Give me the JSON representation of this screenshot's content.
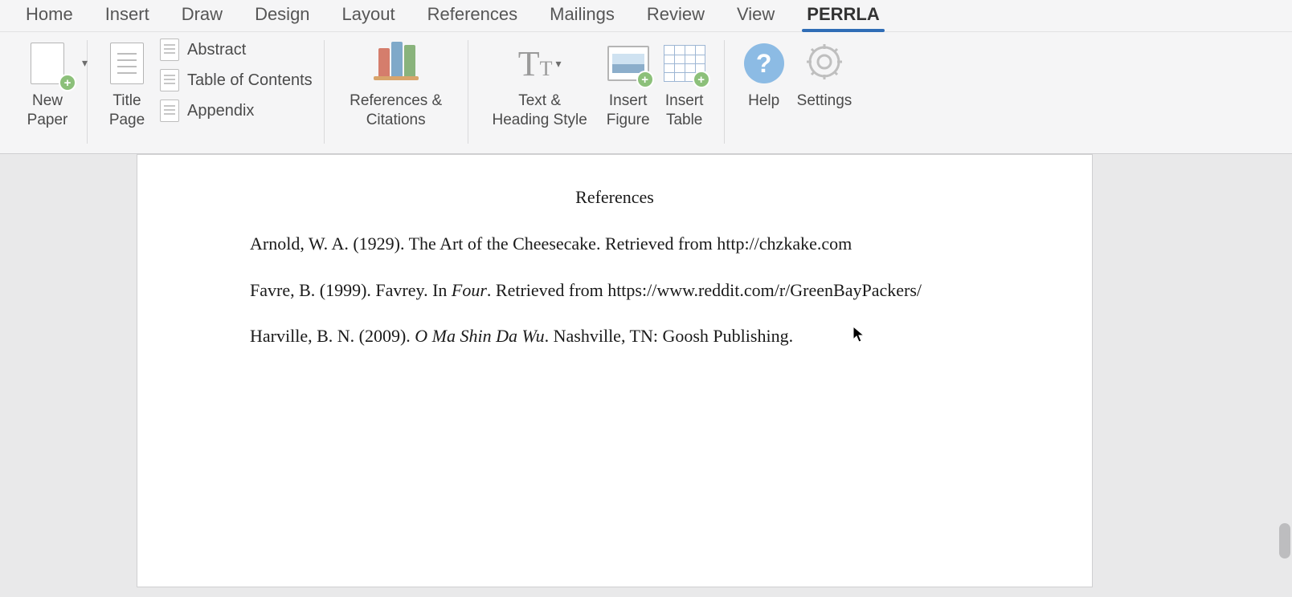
{
  "tabs": {
    "items": [
      {
        "label": "Home"
      },
      {
        "label": "Insert"
      },
      {
        "label": "Draw"
      },
      {
        "label": "Design"
      },
      {
        "label": "Layout"
      },
      {
        "label": "References"
      },
      {
        "label": "Mailings"
      },
      {
        "label": "Review"
      },
      {
        "label": "View"
      },
      {
        "label": "PERRLA"
      }
    ],
    "active_index": 9
  },
  "ribbon": {
    "new_paper": "New\nPaper",
    "title_page": "Title\nPage",
    "abstract": "Abstract",
    "toc": "Table of Contents",
    "appendix": "Appendix",
    "refs_citations": "References &\nCitations",
    "text_heading": "Text &\nHeading Style",
    "insert_figure": "Insert\nFigure",
    "insert_table": "Insert\nTable",
    "help": "Help",
    "settings": "Settings"
  },
  "document": {
    "heading": "References",
    "entries": [
      {
        "prefix": "Arnold, W. A. (1929). The Art of the Cheesecake. Retrieved from http://chzkake.com",
        "italic": "",
        "suffix": ""
      },
      {
        "prefix": "Favre, B. (1999). Favrey. In ",
        "italic": "Four",
        "suffix": ". Retrieved from https://www.reddit.com/r/GreenBayPackers/"
      },
      {
        "prefix": "Harville, B. N. (2009). ",
        "italic": "O Ma Shin Da Wu",
        "suffix": ". Nashville, TN: Goosh Publishing."
      }
    ]
  }
}
